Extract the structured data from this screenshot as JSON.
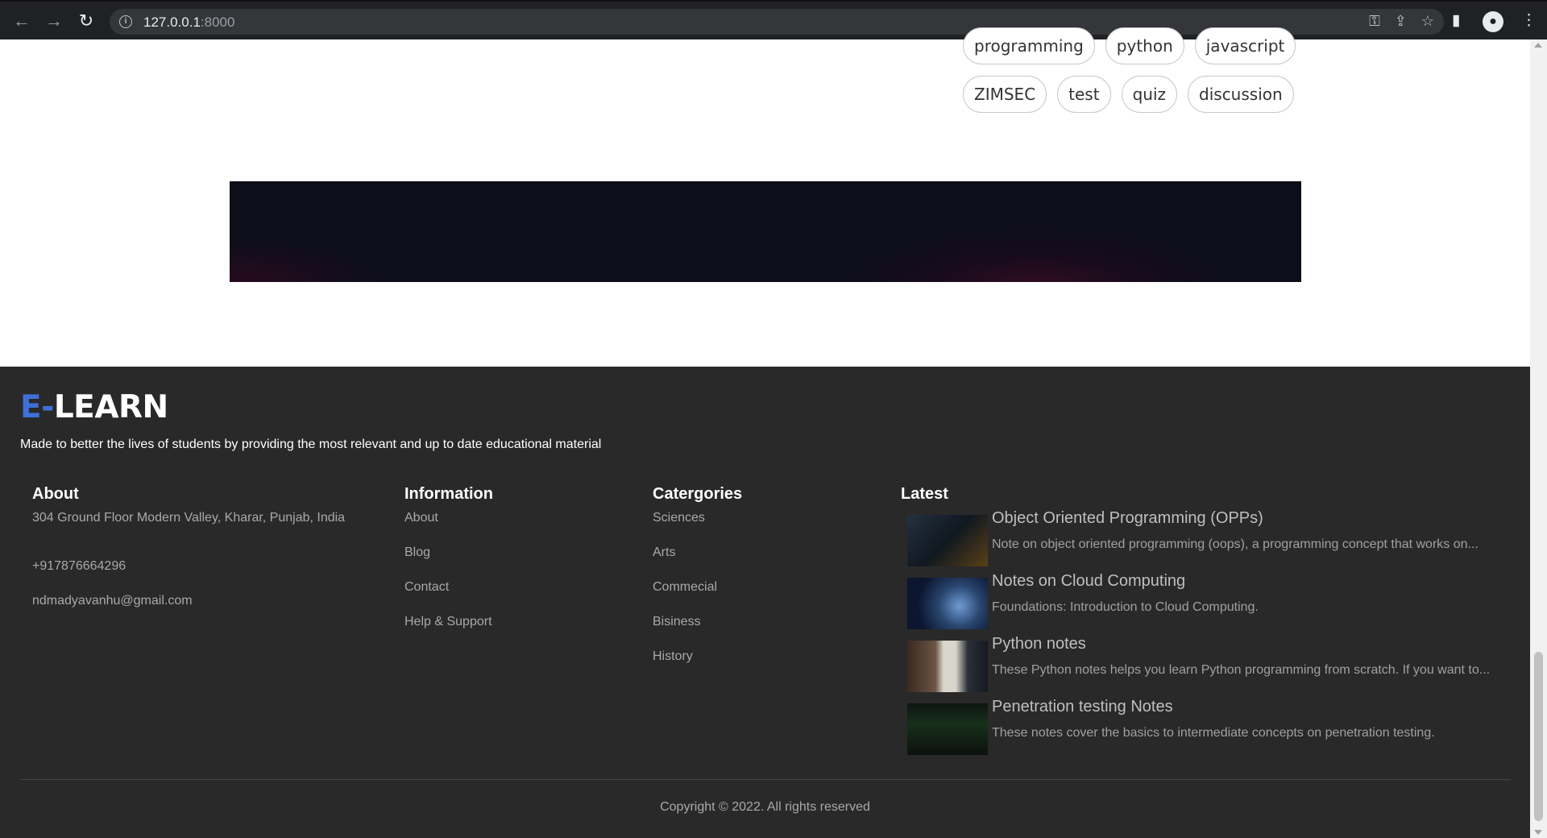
{
  "browser": {
    "url_host": "127.0.0.1",
    "url_port": ":8000"
  },
  "tags": {
    "row1": [
      "programming",
      "python",
      "javascript"
    ],
    "row2": [
      "ZIMSEC",
      "test",
      "quiz",
      "discussion"
    ]
  },
  "footer": {
    "logo_accent": "E-",
    "logo_main": "LEARN",
    "tagline": "Made to better the lives of students by providing the most relevant and up to date educational material",
    "about": {
      "heading": "About",
      "address": "304 Ground Floor Modern Valley, Kharar, Punjab, India",
      "phone": "+917876664296",
      "email": "ndmadyavanhu@gmail.com"
    },
    "information": {
      "heading": "Information",
      "links": [
        "About",
        "Blog",
        "Contact",
        "Help & Support"
      ]
    },
    "categories": {
      "heading": "Catergories",
      "links": [
        "Sciences",
        "Arts",
        "Commecial",
        "Bisiness",
        "History"
      ]
    },
    "latest": {
      "heading": "Latest",
      "items": [
        {
          "title": "Object Oriented Programming (OPPs)",
          "desc": "Note on object oriented programming (oops), a programming concept that works on..."
        },
        {
          "title": "Notes on Cloud Computing",
          "desc": "Foundations: Introduction to Cloud Computing."
        },
        {
          "title": "Python notes",
          "desc": "These Python notes helps you learn Python programming from scratch. If you want to..."
        },
        {
          "title": "Penetration testing Notes",
          "desc": "These notes cover the basics to intermediate concepts on penetration testing."
        }
      ]
    },
    "copyright": "Copyright © 2022. All rights reserved"
  },
  "colors": {
    "footer_bg": "#292929",
    "logo_accent": "#3f6fd8"
  }
}
